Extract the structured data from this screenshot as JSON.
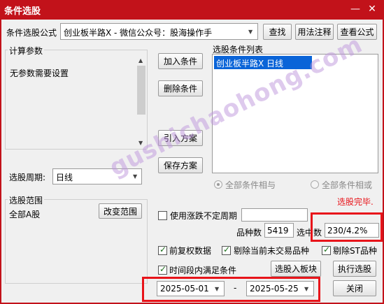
{
  "window": {
    "title": "条件选股",
    "minimize": "—",
    "close": "✕"
  },
  "formula": {
    "label": "条件选股公式",
    "value": "创业板半路X  -  微信公众号：股海操作手",
    "find_btn": "查找",
    "usage_btn": "用法注释",
    "view_btn": "查看公式"
  },
  "params": {
    "title": "计算参数",
    "text": "无参数需要设置"
  },
  "period": {
    "label": "选股周期:",
    "value": "日线"
  },
  "buttons": {
    "add": "加入条件",
    "delete": "删除条件",
    "import": "引入方案",
    "save": "保存方案",
    "to_block": "选股入板块",
    "execute": "执行选股",
    "close": "关闭"
  },
  "conditions": {
    "title": "选股条件列表",
    "items": [
      "创业板半路X  日线"
    ]
  },
  "logic": {
    "and_label": "全部条件相与",
    "or_label": "全部条件相或"
  },
  "status": "选股完毕.",
  "scope": {
    "title": "选股范围",
    "value": "全部A股",
    "change_btn": "改变范围"
  },
  "options": {
    "variable_period": "使用涨跌不定周期",
    "forward_adj": "前复权数据",
    "exclude_no_trade": "剔除当前未交易品种",
    "exclude_st": "剔除ST品种",
    "time_range": "时间段内满足条件"
  },
  "stats": {
    "count_label": "品种数",
    "count_value": "5419",
    "hit_label": "选中数",
    "hit_value": "230/4.2%"
  },
  "dates": {
    "start": "2025-05-01",
    "separator": "-",
    "end": "2025-05-25"
  },
  "watermark": "gushichaohong.com",
  "colors": {
    "accent": "#c2121a",
    "selection": "#0a64d8",
    "status": "#e8141a",
    "highlight_box": "#e8141a"
  }
}
